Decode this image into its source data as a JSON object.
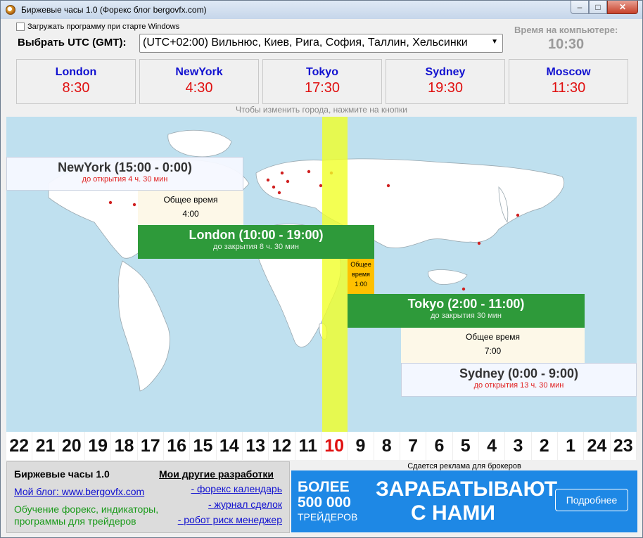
{
  "window": {
    "title": "Биржевые часы 1.0 (Форекс блог bergovfx.com)",
    "minimize": "–",
    "maximize": "□",
    "close": "✕"
  },
  "autostart_label": "Загружать программу при старте Windows",
  "utc": {
    "label": "Выбрать UTC (GMT):",
    "selected": "(UTC+02:00) Вильнюс, Киев, Рига, София, Таллин, Хельсинки"
  },
  "pc_time": {
    "label": "Время на компьютере:",
    "value": "10:30"
  },
  "cities": [
    {
      "name": "London",
      "time": "8:30"
    },
    {
      "name": "NewYork",
      "time": "4:30"
    },
    {
      "name": "Tokyo",
      "time": "17:30"
    },
    {
      "name": "Sydney",
      "time": "19:30"
    },
    {
      "name": "Moscow",
      "time": "11:30"
    }
  ],
  "hint": "Чтобы изменить города, нажмите на кнопки",
  "sessions": {
    "newyork": {
      "title": "NewYork (15:00 - 0:00)",
      "status": "до открытия 4 ч. 30 мин"
    },
    "common1": {
      "label": "Общее время",
      "value": "4:00"
    },
    "london": {
      "title": "London (10:00 - 19:00)",
      "status": "до закрытия 8 ч. 30 мин"
    },
    "common2": {
      "label1": "Общее",
      "label2": "время",
      "value": "1:00"
    },
    "tokyo": {
      "title": "Tokyo (2:00 - 11:00)",
      "status": "до закрытия 30 мин"
    },
    "common3": {
      "label": "Общее время",
      "value": "7:00"
    },
    "sydney": {
      "title": "Sydney (0:00 - 9:00)",
      "status": "до открытия 13 ч. 30 мин"
    }
  },
  "hours": [
    "22",
    "21",
    "20",
    "19",
    "18",
    "17",
    "16",
    "15",
    "14",
    "13",
    "12",
    "11",
    "10",
    "9",
    "8",
    "7",
    "6",
    "5",
    "4",
    "3",
    "2",
    "1",
    "24",
    "23"
  ],
  "current_hour": "10",
  "bottom": {
    "title": "Биржевые часы 1.0",
    "other_title": "Мои другие разработки",
    "blog_link": "Мой блог: www.bergovfx.com",
    "desc": "Обучение форекс, индикаторы, программы для трейдеров",
    "links": [
      "- форекс календарь",
      "- журнал сделок",
      "- робот риск менеджер"
    ]
  },
  "ad": {
    "label": "Сдается реклама для брокеров",
    "line1": "БОЛЕЕ",
    "line2": "500 000",
    "line3": "ТРЕЙДЕРОВ",
    "headline1": "ЗАРАБАТЫВАЮТ",
    "headline2": "С НАМИ",
    "button": "Подробнее"
  },
  "colors": {
    "accent_green": "#2e9a3a",
    "city_name": "#1010d0",
    "city_time": "#e01010",
    "highlight": "#f0ff28"
  }
}
